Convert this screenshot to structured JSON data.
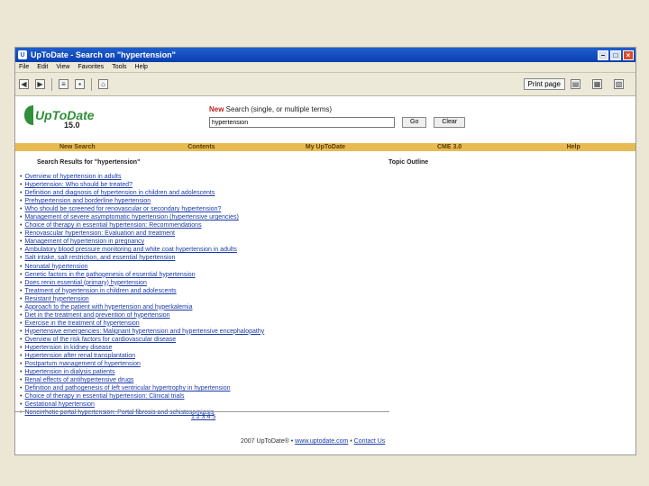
{
  "window": {
    "title": "UpToDate - Search on \"hypertension\""
  },
  "menu": [
    "File",
    "Edit",
    "View",
    "Favorites",
    "Tools",
    "Help"
  ],
  "toolbar": {
    "print_label": "Print page"
  },
  "logo": {
    "name": "UpToDate",
    "version": "15.0"
  },
  "search": {
    "label_new": "New",
    "label_rest": " Search (single, or multiple terms)",
    "value": "hypertension",
    "go_label": "Go",
    "clear_label": "Clear"
  },
  "nav": [
    "New Search",
    "Contents",
    "My UpToDate",
    "CME 3.0",
    "Help"
  ],
  "results": {
    "heading": "Search Results for \"hypertension\"",
    "outline_heading": "Topic Outline",
    "items": [
      "Overview of hypertension in adults",
      "Hypertension: Who should be treated?",
      "Definition and diagnosis of hypertension in children and adolescents",
      "Prehypertension and borderline hypertension",
      "Who should be screened for renovascular or secondary hypertension?",
      "Management of severe asymptomatic hypertension (hypertensive urgencies)",
      "Choice of therapy in essential hypertension: Recommendations",
      "Renovascular hypertension: Evaluation and treatment",
      "Management of hypertension in pregnancy",
      "Ambulatory blood pressure monitoring and white coat hypertension in adults",
      "Salt intake, salt restriction, and essential hypertension",
      "Neonatal hypertension",
      "Genetic factors in the pathogenesis of essential hypertension",
      "Does renin essential (primary) hypertension",
      "Treatment of hypertension in children and adolescents",
      "Resistant hypertension",
      "Approach to the patient with hypertension and hyperkalemia",
      "Diet in the treatment and prevention of hypertension",
      "Exercise in the treatment of hypertension",
      "Hypertensive emergencies: Malignant hypertension and hypertensive encephalopathy",
      "Overview of the risk factors for cardiovascular disease",
      "Hypertension in kidney disease",
      "Hypertension after renal transplantation",
      "Postpartum management of hypertension",
      "Hypertension in dialysis patients",
      "Renal effects of antihypertensive drugs",
      "Definition and pathogenesis of left ventricular hypertrophy in hypertension",
      "Choice of therapy in essential hypertension: Clinical trials",
      "Gestational hypertension",
      "Noncirrhotic portal hypertension: Portal fibrosis and schistosomiasis"
    ],
    "pages": "1 2 3 4 5"
  },
  "footer": {
    "copyright": "2007 UpToDate® • ",
    "site_link": "www.uptodate.com",
    "sep": " • ",
    "contact_link": "Contact Us"
  }
}
